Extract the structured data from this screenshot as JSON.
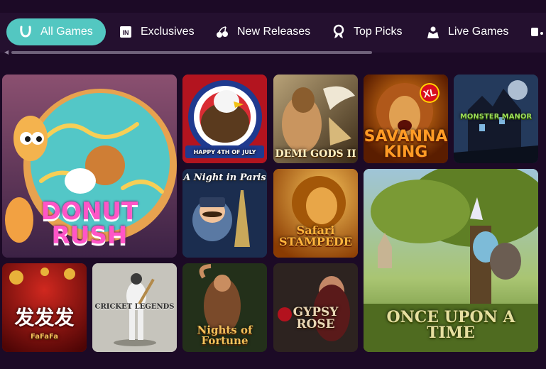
{
  "tabs": [
    {
      "label": "All Games",
      "icon": "horseshoe-icon",
      "active": true
    },
    {
      "label": "Exclusives",
      "icon": "in-badge-icon",
      "active": false
    },
    {
      "label": "New Releases",
      "icon": "cherries-icon",
      "active": false
    },
    {
      "label": "Top Picks",
      "icon": "ribbon-icon",
      "active": false
    },
    {
      "label": "Live Games",
      "icon": "dealer-icon",
      "active": false
    }
  ],
  "games": [
    {
      "title": "DONUT RUSH"
    },
    {
      "title": "HAPPY 4TH OF JULY"
    },
    {
      "title": "DEMI GODS II"
    },
    {
      "title": "SAVANNA KING",
      "badge": "XL"
    },
    {
      "title": "MONSTER MANOR"
    },
    {
      "title": "A Night in Paris"
    },
    {
      "title": "Safari STAMPEDE"
    },
    {
      "title": "ONCE UPON A TIME"
    },
    {
      "title": "发发发",
      "subtitle": "FaFaFa"
    },
    {
      "title": "CRICKET LEGENDS"
    },
    {
      "title": "Nights of Fortune"
    },
    {
      "title": "GYPSY ROSE"
    }
  ],
  "colors": {
    "background": "#1c0a26",
    "tab_bar": "#24102f",
    "active_tab": "#53c7c1"
  }
}
